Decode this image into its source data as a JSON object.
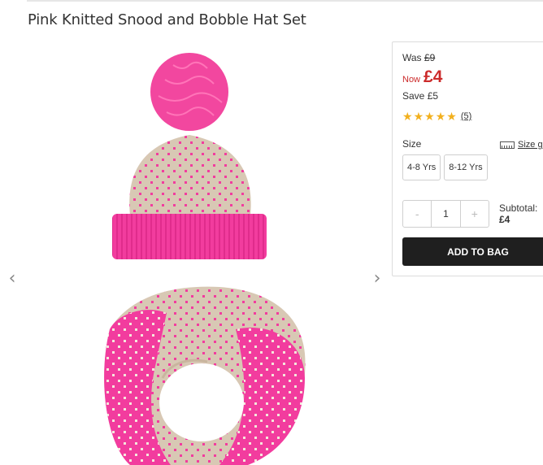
{
  "product": {
    "title": "Pink Knitted Snood and Bobble Hat Set"
  },
  "gallery": {
    "prev_icon": "chevron-left-icon",
    "next_icon": "chevron-right-icon",
    "prev_glyph": "‹",
    "next_glyph": "›"
  },
  "pricing": {
    "was_label": "Was",
    "was_price": "£9",
    "now_label": "Now",
    "now_price": "£4",
    "save_label": "Save",
    "save_amount": "£5"
  },
  "rating": {
    "stars": 5,
    "max": 5,
    "count_text": "(5)"
  },
  "size": {
    "label": "Size",
    "guide_label": "Size gu",
    "options": [
      "4-8 Yrs",
      "8-12 Yrs"
    ]
  },
  "quantity": {
    "minus": "-",
    "value": "1",
    "plus": "+"
  },
  "subtotal": {
    "label": "Subtotal:",
    "value": "£4"
  },
  "cta": {
    "add_label": "ADD TO BAG"
  },
  "colors": {
    "accent_red": "#cc2b2b",
    "star": "#f2b01e",
    "button": "#1f1f1f",
    "knit_pink": "#f23c9e",
    "knit_beige": "#d8c8b4"
  }
}
